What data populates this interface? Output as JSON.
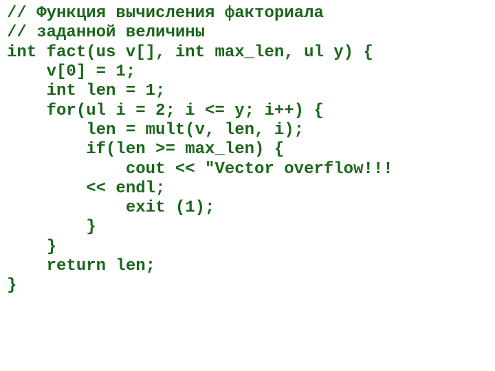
{
  "code": {
    "lines": [
      "// Функция вычисления факториала",
      "// заданной величины",
      "int fact(us v[], int max_len, ul y) {",
      "    v[0] = 1;",
      "    int len = 1;",
      "    for(ul i = 2; i <= y; i++) {",
      "        len = mult(v, len, i);",
      "        if(len >= max_len) {",
      "            cout << \"Vector overflow!!!",
      "        << endl;",
      "            exit (1);",
      "        }",
      "    }",
      "    return len;",
      "}"
    ]
  }
}
